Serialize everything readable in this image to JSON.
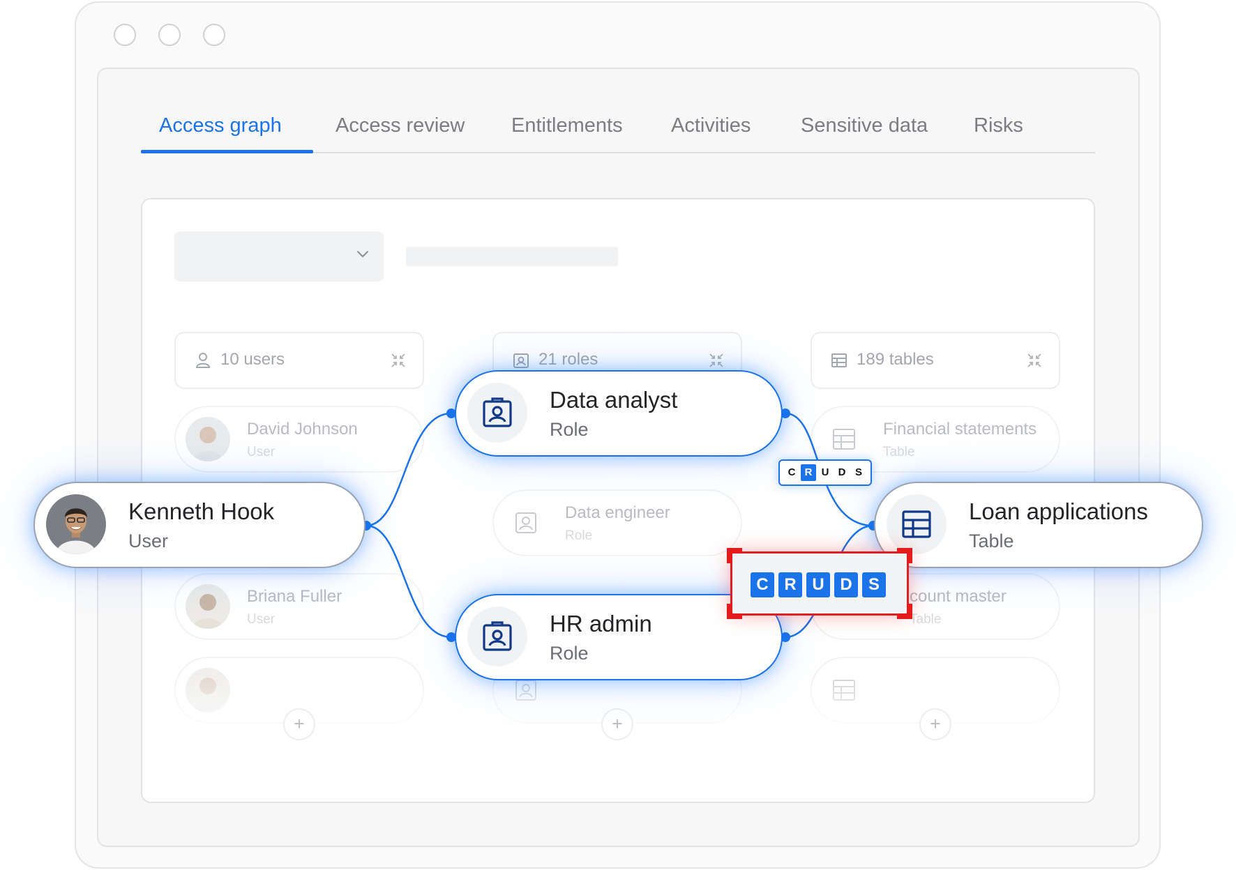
{
  "tabs": [
    {
      "label": "Access graph",
      "active": true
    },
    {
      "label": "Access review",
      "active": false
    },
    {
      "label": "Entitlements",
      "active": false
    },
    {
      "label": "Activities",
      "active": false
    },
    {
      "label": "Sensitive data",
      "active": false
    },
    {
      "label": "Risks",
      "active": false
    }
  ],
  "columns": {
    "users": {
      "label": "10 users",
      "icon": "user-icon"
    },
    "roles": {
      "label": "21 roles",
      "icon": "badge-icon"
    },
    "tables": {
      "label": "189 tables",
      "icon": "table-icon"
    }
  },
  "ghost_items": {
    "users": [
      {
        "name": "David Johnson",
        "type": "User"
      },
      {
        "name": "Briana Fuller",
        "type": "User"
      }
    ],
    "roles": [
      {
        "name": "Data engineer",
        "type": "Role"
      }
    ],
    "tables": [
      {
        "name": "Financial statements",
        "type": "Table"
      },
      {
        "name": "count master",
        "type": "Table"
      }
    ]
  },
  "nodes": {
    "user": {
      "name": "Kenneth Hook",
      "type": "User"
    },
    "role1": {
      "name": "Data analyst",
      "type": "Role"
    },
    "role2": {
      "name": "HR admin",
      "type": "Role"
    },
    "table": {
      "name": "Loan applications",
      "type": "Table"
    }
  },
  "permissions": {
    "small": {
      "letters": [
        "C",
        "R",
        "U",
        "D",
        "S"
      ],
      "active": [
        "R"
      ]
    },
    "big": {
      "letters": [
        "C",
        "R",
        "U",
        "D",
        "S"
      ],
      "active": [
        "C",
        "R",
        "U",
        "D",
        "S"
      ]
    }
  },
  "add_label": "+",
  "colors": {
    "accent": "#1a73e8",
    "alert": "#e02020"
  }
}
